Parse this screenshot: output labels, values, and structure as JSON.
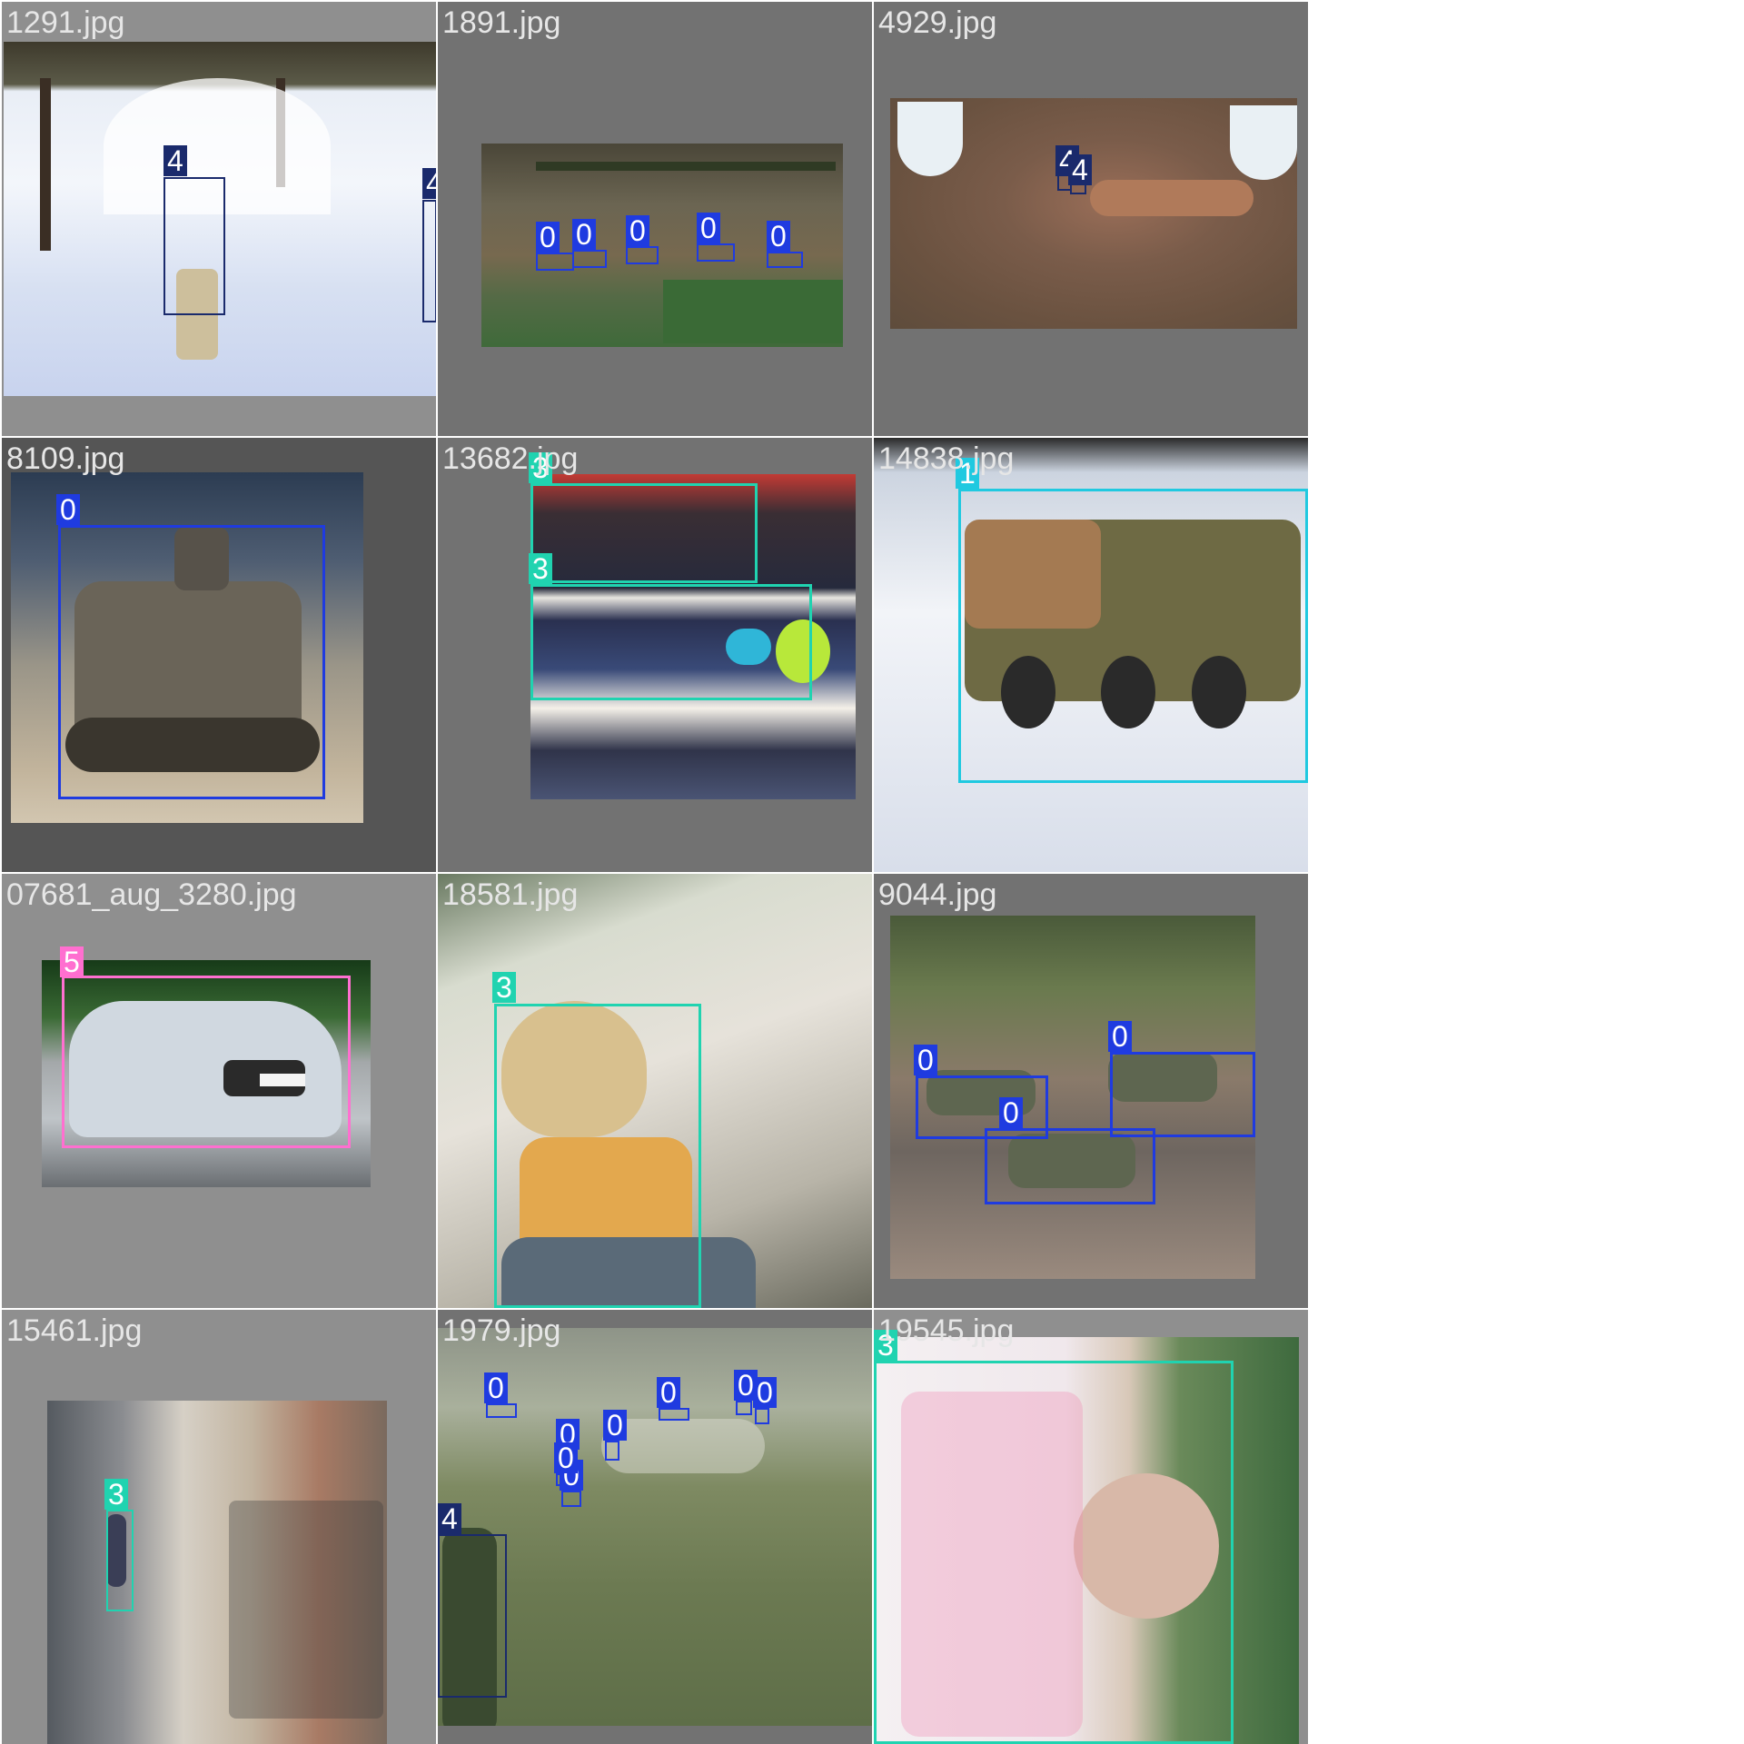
{
  "colors": {
    "class_0": "#1f3be0",
    "class_1": "#1fc9e0",
    "class_3": "#20d3b0",
    "class_4": "#1a2a6c",
    "class_5": "#ff6fd0",
    "pad_dark": "#555555",
    "pad_mid": "#727272",
    "pad_light": "#8f8f8f",
    "separator": "#ffffff"
  },
  "tiles": [
    {
      "filename": "1291.jpg",
      "labels": [
        "4",
        "4"
      ],
      "scene": "snow-soldier"
    },
    {
      "filename": "1891.jpg",
      "labels": [
        "0",
        "0",
        "0",
        "0",
        "0"
      ],
      "scene": "field-tanks"
    },
    {
      "filename": "4929.jpg",
      "labels": [
        "4",
        "4"
      ],
      "scene": "aerial-emblems"
    },
    {
      "filename": "8109.jpg",
      "labels": [
        "0"
      ],
      "scene": "tank-dust"
    },
    {
      "filename": "13682.jpg",
      "labels": [
        "3",
        "3"
      ],
      "scene": "crowd-noise"
    },
    {
      "filename": "14838.jpg",
      "labels": [
        "1"
      ],
      "scene": "apc-snow"
    },
    {
      "filename": "07681_aug_3280.jpg",
      "labels": [
        "5"
      ],
      "scene": "car-road"
    },
    {
      "filename": "18581.jpg",
      "labels": [
        "3"
      ],
      "scene": "woman-sunlight"
    },
    {
      "filename": "9044.jpg",
      "labels": [
        "0",
        "0",
        "0"
      ],
      "scene": "three-tanks"
    },
    {
      "filename": "15461.jpg",
      "labels": [
        "3"
      ],
      "scene": "alley-person"
    },
    {
      "filename": "1979.jpg",
      "labels": [
        "0",
        "0",
        "0",
        "0",
        "0",
        "0",
        "0",
        "0",
        "4"
      ],
      "scene": "grassland-vehicles"
    },
    {
      "filename": "19545.jpg",
      "labels": [
        "3"
      ],
      "scene": "woman-floral"
    }
  ]
}
